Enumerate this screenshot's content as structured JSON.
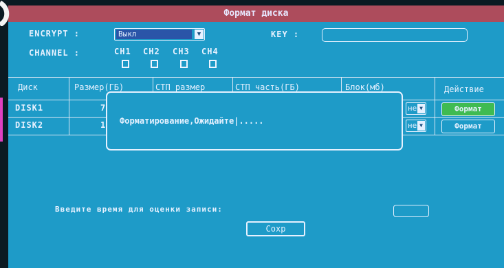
{
  "window": {
    "title": "Формат диска"
  },
  "encrypt": {
    "label": "ENCRYPT :",
    "value": "Выкл"
  },
  "key": {
    "label": "KEY :",
    "value": ""
  },
  "channel": {
    "label": "CHANNEL :",
    "items": [
      {
        "name": "CH1",
        "checked": false
      },
      {
        "name": "CH2",
        "checked": false
      },
      {
        "name": "CH3",
        "checked": false
      },
      {
        "name": "CH4",
        "checked": false
      }
    ]
  },
  "table": {
    "headers": [
      "Диск",
      "Размер(ГБ)",
      "СТП размер",
      "СТП часть(ГБ)",
      "Блок(мб)",
      "Действие"
    ],
    "rows": [
      {
        "disk": "DISK1",
        "size": "7",
        "select_value": "не",
        "action": "Формат",
        "action_active": true
      },
      {
        "disk": "DISK2",
        "size": "1",
        "select_value": "не",
        "action": "Формат",
        "action_active": false
      }
    ]
  },
  "dialog": {
    "message": "Форматирование,Ожидайте|....."
  },
  "record_estimate": {
    "label": "Введите время для оценки записи:",
    "value": ""
  },
  "save_button": "Сохр",
  "colors": {
    "screen_bg": "#1e9bc8",
    "title_bg": "#ad4c5c",
    "active_button": "#3fbb52",
    "text": "#e6f1ff"
  }
}
